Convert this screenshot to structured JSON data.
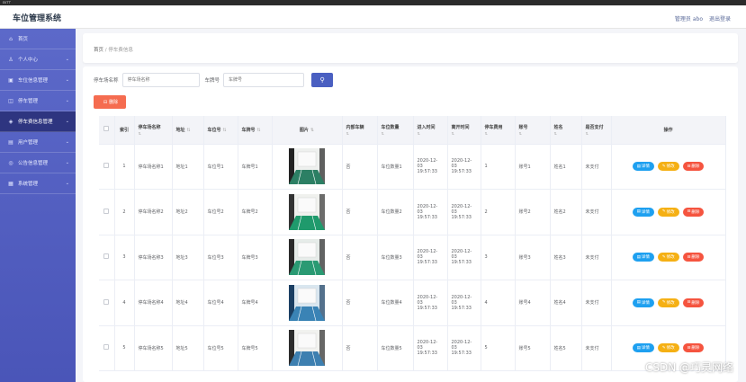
{
  "os": {
    "left": "ᴇᴋᴛᴛ",
    "center": ""
  },
  "app": {
    "title": "车位管理系统",
    "user": "管理员 abo",
    "logout": "退出登录"
  },
  "sidebar": {
    "items": [
      {
        "label": "首页",
        "icon": "home-icon",
        "glyph": "⌂",
        "arrow": false
      },
      {
        "label": "个人中心",
        "icon": "user-icon",
        "glyph": "♙",
        "arrow": true
      },
      {
        "label": "车位信息管理",
        "icon": "car-icon",
        "glyph": "▣",
        "arrow": true
      },
      {
        "label": "停车管理",
        "icon": "parking-icon",
        "glyph": "◫",
        "arrow": true
      },
      {
        "label": "停车费信息管理",
        "icon": "fee-icon",
        "glyph": "◈",
        "arrow": true,
        "active": true
      },
      {
        "label": "用户管理",
        "icon": "users-icon",
        "glyph": "▤",
        "arrow": true
      },
      {
        "label": "公告信息管理",
        "icon": "notice-icon",
        "glyph": "◎",
        "arrow": true
      },
      {
        "label": "系统管理",
        "icon": "settings-icon",
        "glyph": "▦",
        "arrow": true
      }
    ]
  },
  "breadcrumb": {
    "home": "首页",
    "sep": "/",
    "current": "停车费信息"
  },
  "search": {
    "lot_label": "停车场名称",
    "lot_placeholder": "停车场名称",
    "plate_label": "车牌号",
    "plate_placeholder": "车牌号",
    "button_glyph": "⚲"
  },
  "actions": {
    "delete_label": "删除",
    "delete_glyph": "⊟"
  },
  "table": {
    "headers": [
      "索引",
      "停车场名称",
      "地址",
      "车位号",
      "车牌号",
      "图片",
      "内部车辆",
      "车位数量",
      "进入时间",
      "离开时间",
      "停车费用",
      "账号",
      "姓名",
      "是否支付",
      "操作"
    ],
    "sort_glyph": "⇅",
    "rows": [
      {
        "index": "1",
        "lot": "停车场名称1",
        "addr": "地址1",
        "spot": "车位号1",
        "plate": "车牌号1",
        "internal": "否",
        "count": "车位数量1",
        "enter": "2020-12-03 19:57:33",
        "leave": "2020-12-03 19:57:33",
        "fee": "1",
        "account": "账号1",
        "name": "姓名1",
        "paid": "未支付"
      },
      {
        "index": "2",
        "lot": "停车场名称2",
        "addr": "地址2",
        "spot": "车位号2",
        "plate": "车牌号2",
        "internal": "否",
        "count": "车位数量2",
        "enter": "2020-12-03 19:57:33",
        "leave": "2020-12-03 19:57:33",
        "fee": "2",
        "account": "账号2",
        "name": "姓名2",
        "paid": "未支付"
      },
      {
        "index": "3",
        "lot": "停车场名称3",
        "addr": "地址3",
        "spot": "车位号3",
        "plate": "车牌号3",
        "internal": "否",
        "count": "车位数量3",
        "enter": "2020-12-03 19:57:33",
        "leave": "2020-12-03 19:57:33",
        "fee": "3",
        "account": "账号3",
        "name": "姓名3",
        "paid": "未支付"
      },
      {
        "index": "4",
        "lot": "停车场名称4",
        "addr": "地址4",
        "spot": "车位号4",
        "plate": "车牌号4",
        "internal": "否",
        "count": "车位数量4",
        "enter": "2020-12-03 19:57:33",
        "leave": "2020-12-03 19:57:33",
        "fee": "4",
        "account": "账号4",
        "name": "姓名4",
        "paid": "未支付"
      },
      {
        "index": "5",
        "lot": "停车场名称5",
        "addr": "地址5",
        "spot": "车位号5",
        "plate": "车牌号5",
        "internal": "否",
        "count": "车位数量5",
        "enter": "2020-12-03 19:57:33",
        "leave": "2020-12-03 19:57:33",
        "fee": "5",
        "account": "账号5",
        "name": "姓名5",
        "paid": "未支付"
      }
    ],
    "ops": {
      "detail": "详情",
      "edit": "修改",
      "remove": "删除",
      "detail_glyph": "▤",
      "edit_glyph": "✎",
      "remove_glyph": "⊟"
    }
  },
  "watermark": "CSDN @巧灵网络",
  "colors": {
    "sidebar": "#5c69c9",
    "sidebar_active": "#2e3580",
    "primary": "#4a5fc1",
    "danger": "#f56c50",
    "info": "#1ea0f0",
    "warning": "#f5b014"
  }
}
